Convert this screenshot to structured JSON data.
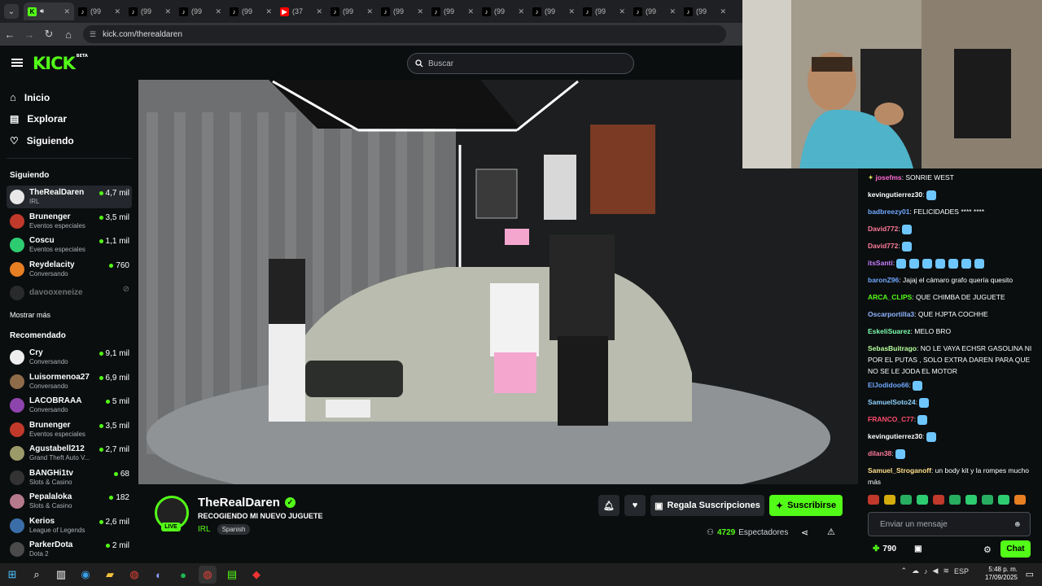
{
  "browser": {
    "tabs": [
      {
        "icon": "kick-icon",
        "label": "",
        "active": true
      },
      {
        "icon": "tiktok-icon",
        "label": "(99"
      },
      {
        "icon": "tiktok-icon",
        "label": "(99"
      },
      {
        "icon": "tiktok-icon",
        "label": "(99"
      },
      {
        "icon": "tiktok-icon",
        "label": "(99"
      },
      {
        "icon": "youtube-icon",
        "label": "(37"
      },
      {
        "icon": "tiktok-icon",
        "label": "(99"
      },
      {
        "icon": "tiktok-icon",
        "label": "(99"
      },
      {
        "icon": "tiktok-icon",
        "label": "(99"
      },
      {
        "icon": "tiktok-icon",
        "label": "(99"
      },
      {
        "icon": "tiktok-icon",
        "label": "(99"
      },
      {
        "icon": "tiktok-icon",
        "label": "(99"
      },
      {
        "icon": "tiktok-icon",
        "label": "(99"
      },
      {
        "icon": "tiktok-icon",
        "label": "(99"
      }
    ],
    "url": "kick.com/therealdaren"
  },
  "kick": {
    "logo": "KICK",
    "logo_badge": "BETA",
    "search_placeholder": "Buscar",
    "nav": [
      {
        "icon": "home-icon",
        "label": "Inicio"
      },
      {
        "icon": "compass-icon",
        "label": "Explorar"
      },
      {
        "icon": "heart-icon",
        "label": "Siguiendo"
      }
    ],
    "following_title": "Siguiendo",
    "following": [
      {
        "name": "TheRealDaren",
        "sub": "IRL",
        "viewers": "4,7 mil",
        "color": "#e8e8e8",
        "selected": true
      },
      {
        "name": "Brunenger",
        "sub": "Eventos especiales",
        "viewers": "3,5 mil",
        "color": "#c0392b"
      },
      {
        "name": "Coscu",
        "sub": "Eventos especiales",
        "viewers": "1,1 mil",
        "color": "#2ecc71"
      },
      {
        "name": "Reydelacity",
        "sub": "Conversando",
        "viewers": "760",
        "color": "#e67e22"
      },
      {
        "name": "davooxeneize",
        "sub": "",
        "viewers": "",
        "color": "#555",
        "offline": true
      }
    ],
    "show_more": "Mostrar más",
    "recommended_title": "Recomendado",
    "recommended": [
      {
        "name": "Cry",
        "sub": "Conversando",
        "viewers": "9,1 mil",
        "color": "#eeeeee"
      },
      {
        "name": "Luisormenoa27",
        "sub": "Conversando",
        "viewers": "6,9 mil",
        "color": "#8e6c4a"
      },
      {
        "name": "LACOBRAAA",
        "sub": "Conversando",
        "viewers": "5 mil",
        "color": "#8e44ad"
      },
      {
        "name": "Brunenger",
        "sub": "Eventos especiales",
        "viewers": "3,5 mil",
        "color": "#c0392b"
      },
      {
        "name": "Agustabell212",
        "sub": "Grand Theft Auto V...",
        "viewers": "2,7 mil",
        "color": "#9b9b6a"
      },
      {
        "name": "BANGHi1tv",
        "sub": "Slots & Casino",
        "viewers": "68",
        "color": "#333333"
      },
      {
        "name": "Pepalaloka",
        "sub": "Slots & Casino",
        "viewers": "182",
        "color": "#b57a8c"
      },
      {
        "name": "Kerios",
        "sub": "League of Legends",
        "viewers": "2,6 mil",
        "color": "#3b6ea8"
      },
      {
        "name": "ParkerDota",
        "sub": "Dota 2",
        "viewers": "2 mil",
        "color": "#4a4a4a"
      }
    ]
  },
  "stream": {
    "streamer": "TheRealDaren",
    "title": "RECOGIENDO MI NUEVO JUGUETE",
    "category": "IRL",
    "language": "Spanish",
    "live_label": "LIVE",
    "gift_label": "Regala Suscripciones",
    "subscribe_label": "Suscribirse",
    "viewers_count": "4729",
    "viewers_label": "Espectadores"
  },
  "chat": {
    "messages": [
      {
        "user": "josefms",
        "color": "#ff6bd6",
        "text": "SONRIE WEST",
        "badge": true
      },
      {
        "user": "kevingutierrez30",
        "color": "#ffffff",
        "text": "",
        "emotes": 1
      },
      {
        "user": "badbreezy01",
        "color": "#6fa8ff",
        "text": "FELICIDADES **** ****"
      },
      {
        "user": "David772",
        "color": "#ff7b9c",
        "text": "",
        "emotes": 1
      },
      {
        "user": "David772",
        "color": "#ff7b9c",
        "text": "",
        "emotes": 1
      },
      {
        "user": "itsSanti",
        "color": "#c77dff",
        "text": "",
        "emotes": 7
      },
      {
        "user": "baronZ96",
        "color": "#6fa8ff",
        "text": "Jajaj el cámaro grafo quería quesito"
      },
      {
        "user": "ARCA_CLIPS",
        "color": "#53fc18",
        "text": "QUE CHIMBA DE JUGUETE"
      },
      {
        "user": "Oscarportilla3",
        "color": "#8fb5ff",
        "text": "QUE HJPTA COCHHE"
      },
      {
        "user": "EskeliSuarez",
        "color": "#7dffb0",
        "text": "MELO BRO"
      },
      {
        "user": "SebasBuitrago",
        "color": "#b8ff9f",
        "text": "NO LE VAYA ECHSR GASOLINA NI POR EL PUTAS , SOLO EXTRA DAREN PARA QUE NO SE LE JODA EL MOTOR"
      },
      {
        "user": "ElJodidoo66",
        "color": "#6fa8ff",
        "text": "",
        "emotes": 1
      },
      {
        "user": "SamuelSoto24",
        "color": "#8fd3ff",
        "text": "",
        "emotes": 1
      },
      {
        "user": "FRANCO_C77",
        "color": "#ff4d6d",
        "text": "",
        "emotes": 1
      },
      {
        "user": "kevingutierrez30",
        "color": "#ffffff",
        "text": "",
        "emotes": 1
      },
      {
        "user": "dilan38",
        "color": "#ff7b9c",
        "text": "",
        "emotes": 1
      },
      {
        "user": "Samuel_Stroganoff",
        "color": "#ffe08a",
        "text": "un body kit y la rompes mucho más"
      }
    ],
    "input_placeholder": "Enviar un mensaje",
    "points": "790",
    "send_label": "Chat"
  },
  "taskbar": {
    "lang": "ESP",
    "time": "5:48 p. m.",
    "date": "17/09/2025"
  }
}
